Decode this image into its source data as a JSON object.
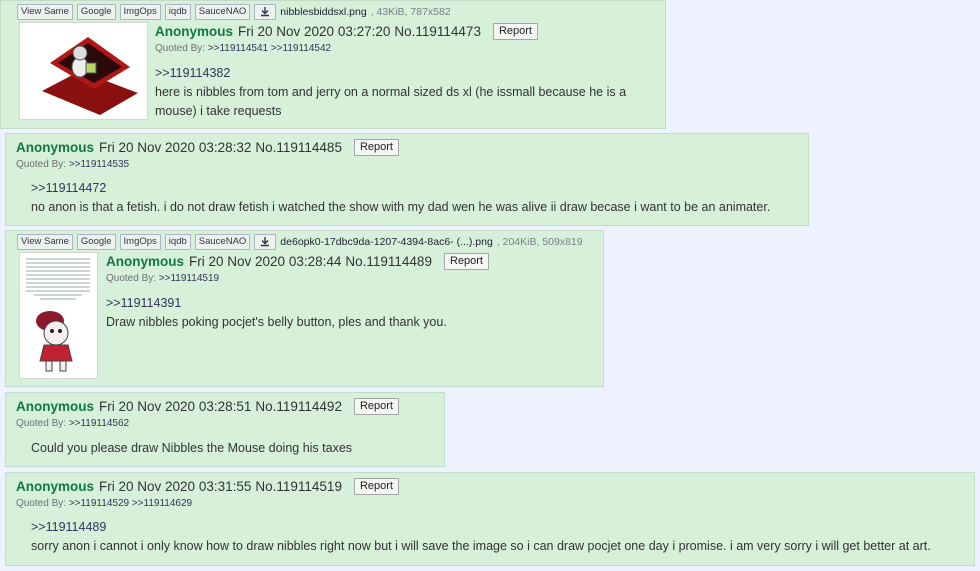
{
  "colors": {
    "post_bg": "#d6f0da",
    "name": "#117743",
    "page_bg": "#eef2ff"
  },
  "file_buttons": [
    "View Same",
    "Google",
    "ImgOps",
    "iqdb",
    "SauceNAO"
  ],
  "report_label": "Report",
  "quoted_by_label": "Quoted By:",
  "posts": [
    {
      "file": {
        "name": "nibblesbiddsxl.png",
        "meta": ", 43KiB, 787x582"
      },
      "name": "Anonymous",
      "datetime": "Fri 20 Nov 2020 03:27:20",
      "postno": "No.119114473",
      "quoted_by": ">>119114541 >>119114542",
      "reply_to": ">>119114382",
      "text": "here is nibbles from tom and jerry on a normal sized ds xl (he issmall because he is a mouse) i take requests"
    },
    {
      "name": "Anonymous",
      "datetime": "Fri 20 Nov 2020 03:28:32",
      "postno": "No.119114485",
      "quoted_by": ">>119114535",
      "reply_to": ">>119114472",
      "text": "no anon is that a fetish. i do not draw fetish i watched the show with my dad wen he was alive ii draw becase i want to be an animater."
    },
    {
      "file": {
        "name": "de6opk0-17dbc9da-1207-4394-8ac6- (...).png",
        "meta": ", 204KiB, 509x819"
      },
      "name": "Anonymous",
      "datetime": "Fri 20 Nov 2020 03:28:44",
      "postno": "No.119114489",
      "quoted_by": ">>119114519",
      "reply_to": ">>119114391",
      "text": "Draw nibbles poking pocjet's belly button, ples and thank you."
    },
    {
      "name": "Anonymous",
      "datetime": "Fri 20 Nov 2020 03:28:51",
      "postno": "No.119114492",
      "quoted_by": ">>119114562",
      "reply_to": "",
      "text": "Could you please draw Nibbles the Mouse doing his taxes"
    },
    {
      "name": "Anonymous",
      "datetime": "Fri 20 Nov 2020 03:31:55",
      "postno": "No.119114519",
      "quoted_by": ">>119114529 >>119114629",
      "reply_to": ">>119114489",
      "text": "sorry anon i cannot i only know how to draw nibbles right now but i will save the image so i can draw pocjet one day i promise. i am very sorry i will get better at art."
    }
  ]
}
